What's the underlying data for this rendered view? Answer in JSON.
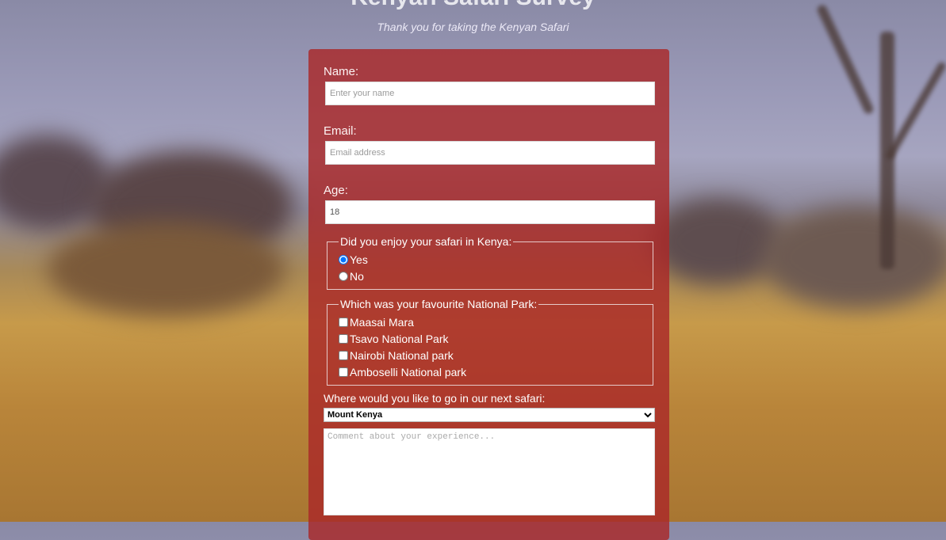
{
  "page": {
    "subtitle": "Thank you for taking the Kenyan Safari",
    "heading": "Kenyan Safari Survey"
  },
  "form": {
    "name_label": "Name:",
    "name_placeholder": "Enter your name",
    "email_label": "Email:",
    "email_placeholder": "Email address",
    "age_label": "Age:",
    "age_value": "18",
    "enjoy": {
      "legend": "Did you enjoy your safari in Kenya:",
      "options": [
        "Yes",
        "No"
      ],
      "selected": "Yes"
    },
    "parks": {
      "legend": "Which was your favourite National Park:",
      "options": [
        "Maasai Mara",
        "Tsavo National Park",
        "Nairobi National park",
        "Amboselli National park"
      ]
    },
    "next_label": "Where would you like to go in our next safari:",
    "next_selected": "Mount Kenya",
    "comment_placeholder": "Comment about your experience..."
  }
}
